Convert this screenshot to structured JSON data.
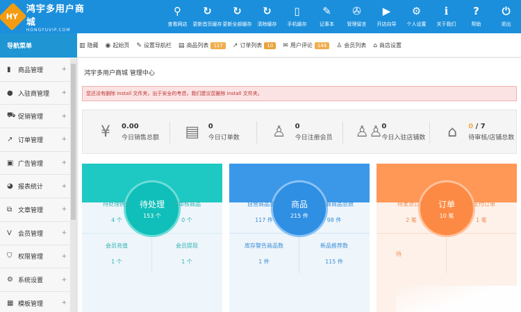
{
  "brand": {
    "badge": "HY",
    "name": "鸿宇多用户商城",
    "subtitle": "HONGYUVIP.COM"
  },
  "topnav": [
    {
      "icon": "search-icon",
      "glyph": "⚲",
      "label": "查看网店"
    },
    {
      "icon": "refresh-icon",
      "glyph": "↻",
      "label": "更新首页缓存"
    },
    {
      "icon": "refresh-icon",
      "glyph": "↻",
      "label": "更新全部缓存"
    },
    {
      "icon": "refresh-icon",
      "glyph": "↻",
      "label": "清除缓存"
    },
    {
      "icon": "mobile-icon",
      "glyph": "▯",
      "label": "手机缓存"
    },
    {
      "icon": "notebook-icon",
      "glyph": "✎",
      "label": "记事本"
    },
    {
      "icon": "wrench-icon",
      "glyph": "✇",
      "label": "管理留言"
    },
    {
      "icon": "play-icon",
      "glyph": "▶",
      "label": "开店向导"
    },
    {
      "icon": "gear-icon",
      "glyph": "⚙",
      "label": "个人设置"
    },
    {
      "icon": "info-icon",
      "glyph": "ℹ",
      "label": "关于我们"
    },
    {
      "icon": "help-icon",
      "glyph": "?",
      "label": "帮助"
    },
    {
      "icon": "power-icon",
      "glyph": "⏻",
      "label": "退出"
    }
  ],
  "nav_title": "导航菜单",
  "quickbar": {
    "hide": "隐藏",
    "home": "起始页",
    "set_nav": "设置导航栏",
    "goods_list": "商品列表",
    "goods_count": "117",
    "order_list": "订单列表",
    "order_count": "10",
    "user_comments": "用户评论",
    "comment_count": "144",
    "member_list": "会员列表",
    "shop_settings": "商店设置"
  },
  "sidebar": [
    {
      "icon": "product-icon",
      "glyph": "▮",
      "label": "商品管理"
    },
    {
      "icon": "store-icon",
      "glyph": "●",
      "label": "入驻商管理"
    },
    {
      "icon": "cart-icon",
      "glyph": "⛟",
      "label": "促销管理"
    },
    {
      "icon": "order-icon",
      "glyph": "↗",
      "label": "订单管理"
    },
    {
      "icon": "image-icon",
      "glyph": "▣",
      "label": "广告管理"
    },
    {
      "icon": "chart-icon",
      "glyph": "◕",
      "label": "报表统计"
    },
    {
      "icon": "article-icon",
      "glyph": "⧉",
      "label": "文章管理"
    },
    {
      "icon": "vip-icon",
      "glyph": "V",
      "label": "会员管理"
    },
    {
      "icon": "shield-icon",
      "glyph": "⛉",
      "label": "权限管理"
    },
    {
      "icon": "gears-icon",
      "glyph": "⚙",
      "label": "系统设置"
    },
    {
      "icon": "template-icon",
      "glyph": "▦",
      "label": "模板管理"
    }
  ],
  "main": {
    "title": "鸿宇多用户商城 管理中心",
    "notice": "您还没有删除 install 文件夹，出于安全的考虑，我们建议您删除 install 文件夹。"
  },
  "stats": [
    {
      "icon": "yen-icon",
      "glyph": "¥",
      "value": "0.00",
      "label": "今日销售总额"
    },
    {
      "icon": "clipboard-icon",
      "glyph": "▤",
      "value": "0",
      "label": "今日订单数"
    },
    {
      "icon": "user-icon",
      "glyph": "♙",
      "value": "0",
      "label": "今日注册会员"
    },
    {
      "icon": "users-icon",
      "glyph": "♙♙",
      "value": "0",
      "label": "今日入驻店铺数"
    },
    {
      "icon": "shop-icon",
      "glyph": "⌂",
      "value_accent": "0",
      "value_rest": " / 7",
      "label": "待审核/店铺总数"
    }
  ],
  "cards": [
    {
      "title": "待处理",
      "value": "153 个",
      "cells": [
        {
          "label": "待处理佣金",
          "value": "4 个"
        },
        {
          "label": "待审核商品",
          "value": "0 个"
        },
        {
          "label": "会员充值",
          "value": "1 个"
        },
        {
          "label": "会员提现",
          "value": "1 个"
        }
      ]
    },
    {
      "title": "商品",
      "value": "215 件",
      "cells": [
        {
          "label": "自营商品总数",
          "value": "117 件"
        },
        {
          "label": "入驻商商品总数",
          "value": "98 件"
        },
        {
          "label": "库存警告商品数",
          "value": "1 件"
        },
        {
          "label": "新品推荐数",
          "value": "115 件"
        }
      ]
    },
    {
      "title": "订单",
      "value": "10 笔",
      "cells": [
        {
          "label": "待发货订单",
          "value": "2 笔"
        },
        {
          "label": "待支付订单",
          "value": "1 笔"
        },
        {
          "label": "待",
          "value": ""
        }
      ]
    }
  ],
  "colors": {
    "header": "#1b8fdc",
    "teal": "#1ec9c4",
    "blue": "#3b98e9",
    "orange": "#ff9857",
    "notice_text": "#b33333"
  }
}
